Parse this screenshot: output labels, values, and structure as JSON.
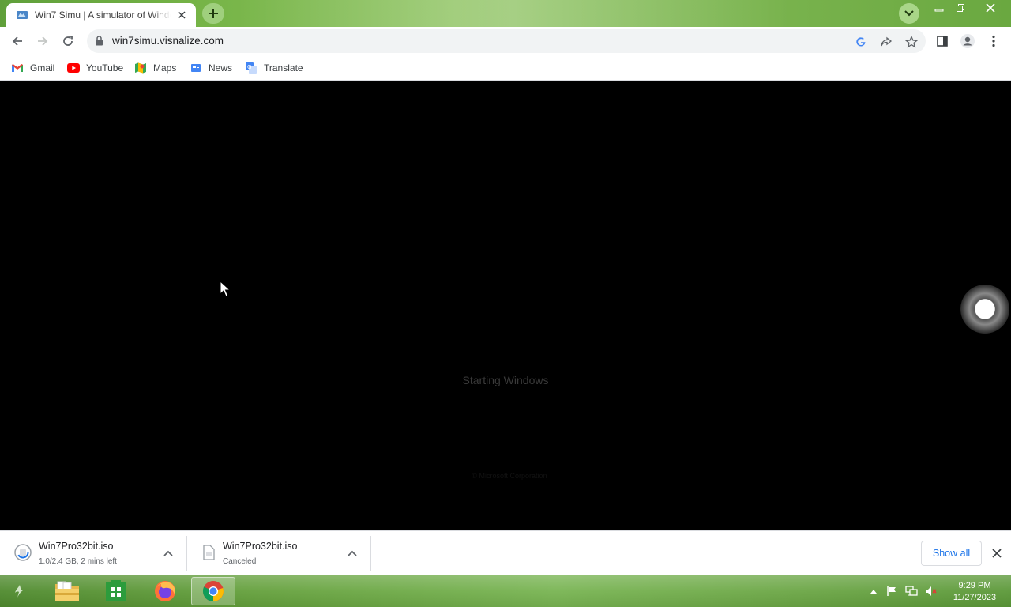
{
  "browser": {
    "tab": {
      "title": "Win7 Simu | A simulator of Windows 7"
    },
    "address_bar": {
      "url": "win7simu.visnalize.com"
    },
    "bookmarks": [
      {
        "label": "Gmail",
        "icon": "gmail-icon"
      },
      {
        "label": "YouTube",
        "icon": "youtube-icon"
      },
      {
        "label": "Maps",
        "icon": "maps-icon"
      },
      {
        "label": "News",
        "icon": "news-icon"
      },
      {
        "label": "Translate",
        "icon": "translate-icon"
      }
    ]
  },
  "page": {
    "boot_text": "Starting Windows",
    "copyright_text": "© Microsoft Corporation"
  },
  "downloads": {
    "items": [
      {
        "name": "Win7Pro32bit.iso",
        "status": "1.0/2.4 GB, 2 mins left"
      },
      {
        "name": "Win7Pro32bit.iso",
        "status": "Canceled"
      }
    ],
    "show_all_label": "Show all"
  },
  "taskbar": {
    "pinned": [
      "file-explorer-icon",
      "store-icon",
      "firefox-icon",
      "chrome-icon"
    ],
    "clock": {
      "time": "9:29 PM",
      "date": "11/27/2023"
    }
  },
  "colors": {
    "theme_green": "#76b447",
    "taskbar_green": "#64a03c",
    "link_blue": "#1a73e8"
  }
}
